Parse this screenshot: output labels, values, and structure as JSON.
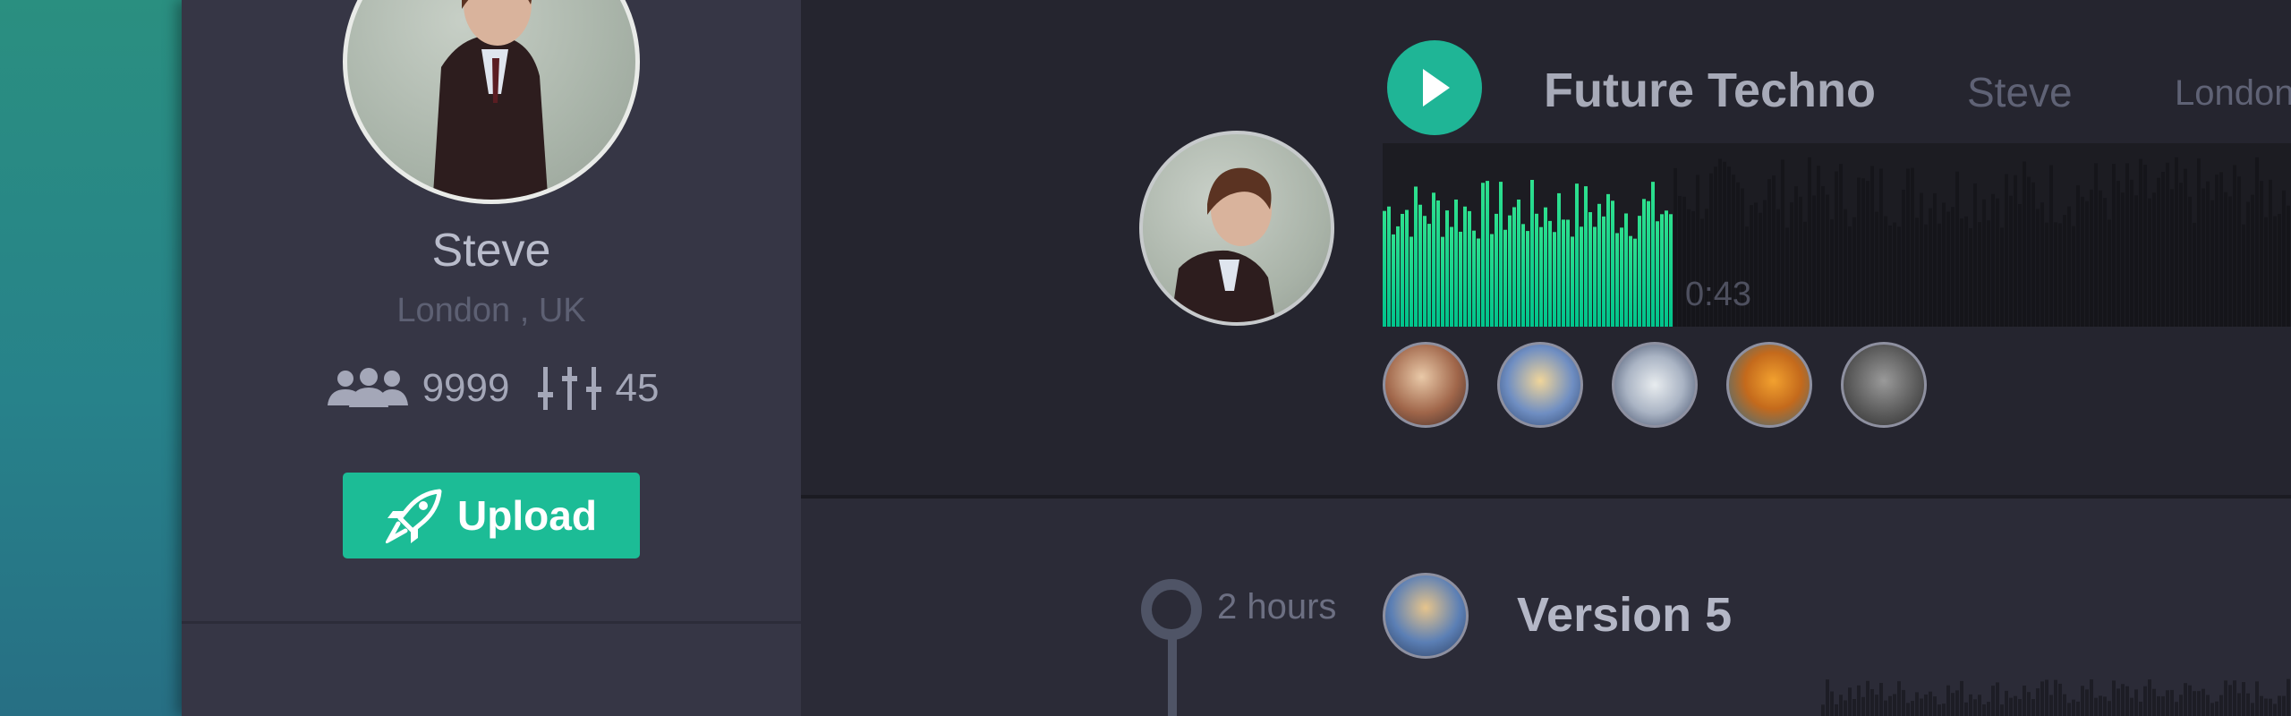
{
  "profile": {
    "name": "Steve",
    "location": "London , UK",
    "followers": "9999",
    "tracks": "45",
    "upload_label": "Upload"
  },
  "track": {
    "title": "Future Techno",
    "artist": "Steve",
    "location": "London",
    "current_time": "0:43",
    "progress": 0.2
  },
  "listeners": [
    {
      "name": "listener-1"
    },
    {
      "name": "listener-2"
    },
    {
      "name": "listener-3"
    },
    {
      "name": "listener-4"
    },
    {
      "name": "listener-5"
    }
  ],
  "timeline": {
    "time_ago": "2 hours",
    "version_title": "Version 5"
  },
  "colors": {
    "accent": "#1cbc96",
    "wave_played_top": "#2ee08e",
    "wave_played_bottom": "#00c48c",
    "wave_unplayed": "#15151a"
  }
}
